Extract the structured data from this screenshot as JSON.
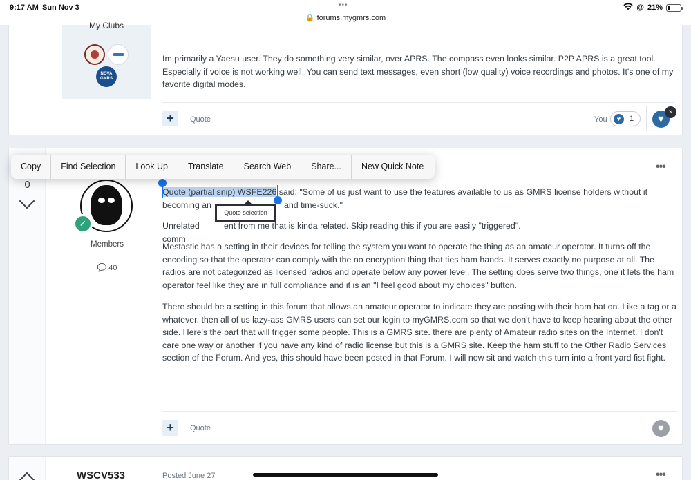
{
  "statusbar": {
    "time": "9:17 AM",
    "date": "Sun Nov 3",
    "dots": "•••",
    "url": "forums.mygmrs.com",
    "wifi_icon": "wifi-icon",
    "battery": "21%"
  },
  "post1": {
    "my_clubs": "My Clubs",
    "club3_label": "NOVA GMRS",
    "text": "Im primarily a Yaesu user. They do something very similar, over APRS.  The compass even looks similar. P2P APRS is a great tool. Especially if voice is not working well. You can send text messages, even short (low quality) voice recordings and photos. It's one of my favorite digital modes.",
    "quote_label": "Quote",
    "you_label": "You",
    "reaction_count": "1"
  },
  "post2": {
    "vote_count": "0",
    "members_label": "Members",
    "posts_count": "40",
    "quote_highlight": "Quote (partial snip) WSFE226",
    "quote_line1_rest": " said: \"Some of us just want to use the features available to us as GMRS license holders without it",
    "quote_line2_start": "becoming an",
    "quote_line2_end": "and time-suck.\"",
    "para_unrelated_start": "Unrelated comm",
    "para_unrelated_end": "ent from me that is kinda related. Skip reading this if you are easily \"triggered\".",
    "para_meshtastic": "Mestastic has a setting in their devices for telling the system you want to operate the thing as an amateur operator. It turns off the encoding so that the operator can comply with the no encryption thing that ties ham hands. It serves exactly no purpose at all. The radios are not categorized as licensed radios and operate below any power level. The setting does serve two things, one it lets the ham operator feel like they are in full compliance and it is an \"I feel good about my choices\" button.",
    "para_setting": "There should be a setting in this forum that allows an amateur operator to indicate they are posting with their ham hat on. Like a tag or a whatever. then all of us lazy-ass GMRS users can set our login to myGMRS.com so that we don't have to keep hearing about the other side. Here's the part that will trigger some people. This is a GMRS site. there are plenty of Amateur radio sites on the Internet. I don't care one way or another if you have any kind of radio license but this is a GMRS site. Keep the ham stuff to the Other Radio Services section of the Forum. And yes, this should have been posted in that Forum. I will now sit and watch this turn into a front yard fist fight.",
    "quote_label": "Quote"
  },
  "context_menu": {
    "items": [
      "Copy",
      "Find Selection",
      "Look Up",
      "Translate",
      "Search Web",
      "Share...",
      "New Quick Note"
    ]
  },
  "quote_selection_label": "Quote selection",
  "post3": {
    "author": "WSCV533",
    "posted": "Posted June 27"
  },
  "colors": {
    "accent": "#2d6aa3",
    "highlight": "#b9d3f0",
    "rank_badge": "#2ea27a",
    "page_bg": "#ebeef2"
  }
}
